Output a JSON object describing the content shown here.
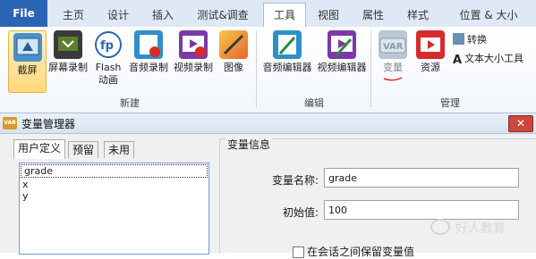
{
  "ribbon_tabs": [
    "File",
    "主页",
    "设计",
    "插入",
    "测试&调查",
    "工具",
    "视图",
    "属性",
    "样式",
    "位置 & 大小"
  ],
  "active_tab": "工具",
  "groups": {
    "new": {
      "label": "新建",
      "buttons": [
        "截屏",
        "屏幕录制",
        "Flash\n动画",
        "音频录制",
        "视频录制",
        "图像"
      ]
    },
    "edit": {
      "label": "编辑",
      "buttons": [
        "音频编辑器",
        "视频编辑器"
      ]
    },
    "manage": {
      "label": "管理",
      "buttons": [
        "变量",
        "资源"
      ],
      "small_buttons": [
        "转换",
        "文本大小工具"
      ]
    }
  },
  "dialog": {
    "title": "变量管理器",
    "close_glyph": "✕",
    "tabs": [
      "用户定义",
      "预留",
      "未用"
    ],
    "variables": [
      "grade",
      "x",
      "y"
    ],
    "info_title": "变量信息",
    "name_label": "变量名称:",
    "name_value": "grade",
    "init_label": "初始值:",
    "init_value": "100",
    "retain_label": "在会话之间保留变量值"
  },
  "watermark": "好人教育",
  "colors": {
    "file_tab": "#2b64b2",
    "accent_red": "#c9483b",
    "highlight": "#ffd77a"
  }
}
